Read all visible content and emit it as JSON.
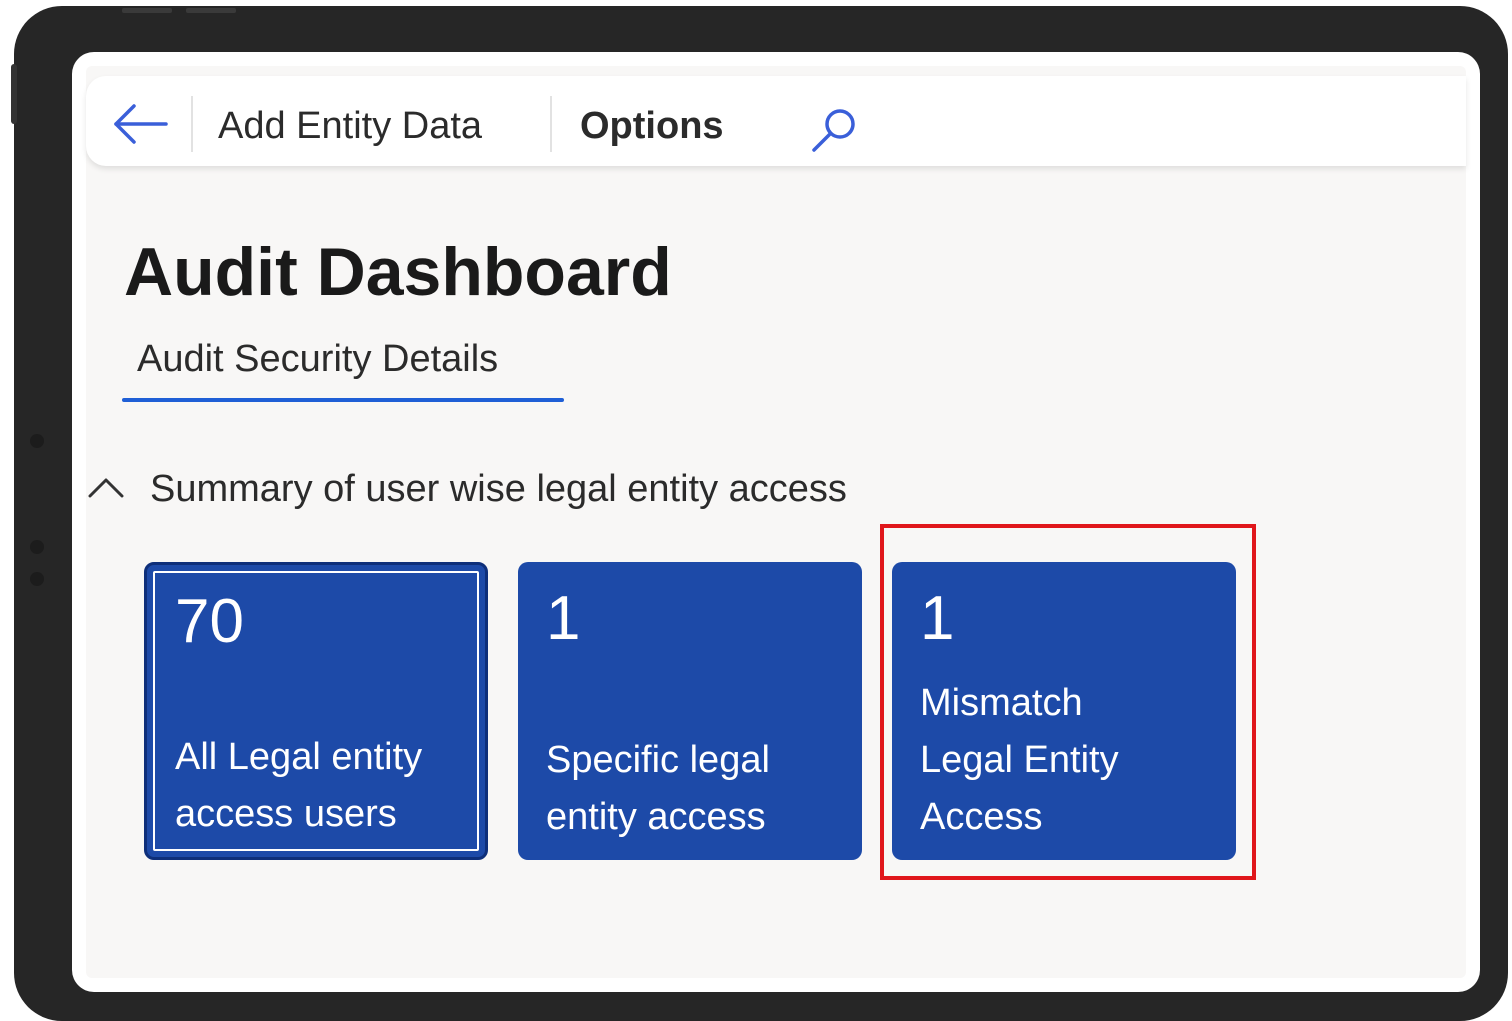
{
  "toolbar": {
    "back_icon": "back-arrow-icon",
    "add_entity_label": "Add Entity Data",
    "options_label": "Options",
    "search_icon": "search-icon"
  },
  "page": {
    "title": "Audit Dashboard"
  },
  "tabs": [
    {
      "label": "Audit Security Details",
      "selected": true
    }
  ],
  "section": {
    "chevron_icon": "chevron-up-icon",
    "title": "Summary of user wise legal entity access",
    "expanded": true
  },
  "tiles": [
    {
      "count": "70",
      "label": "All Legal entity access users",
      "selected": true
    },
    {
      "count": "1",
      "label": "Specific legal entity access",
      "selected": false
    },
    {
      "count": "1",
      "label": "Mismatch Legal Entity Access",
      "selected": false,
      "highlighted": true
    }
  ],
  "colors": {
    "tile_background": "#1d4aa8",
    "tab_underline": "#1f5fd6",
    "highlight_border": "#e0161b",
    "icon_blue": "#3a5fd9",
    "device_frame": "#262626",
    "canvas_background": "#f8f7f6"
  }
}
